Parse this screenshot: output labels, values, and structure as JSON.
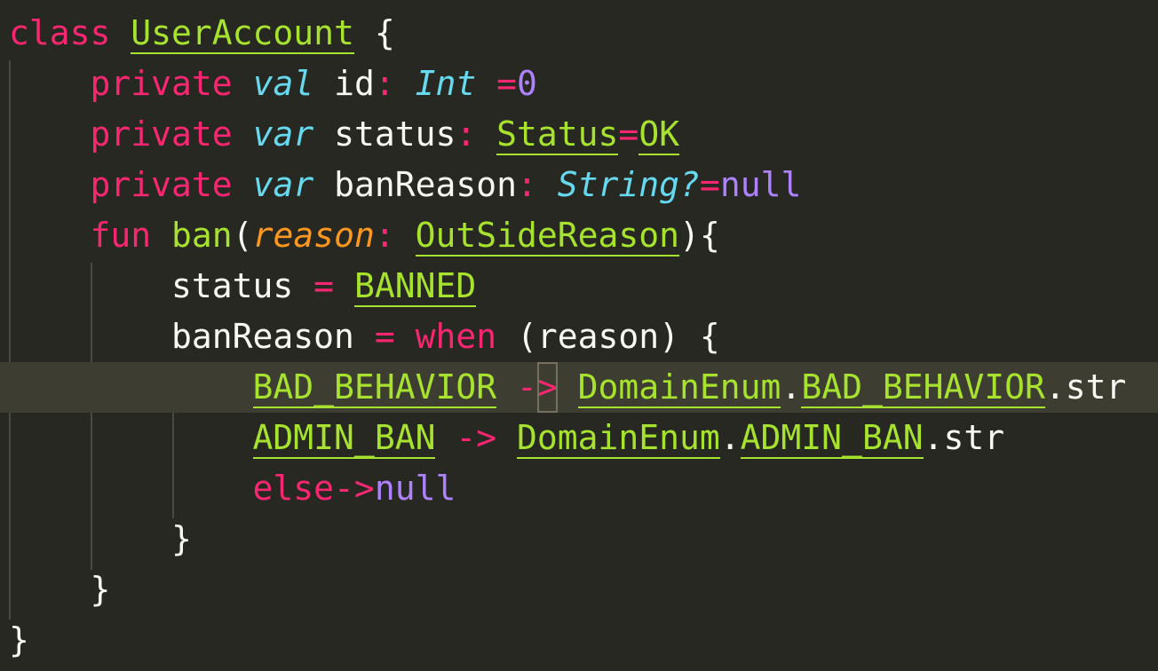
{
  "editor": {
    "lines": [
      [
        [
          "kw",
          "class"
        ],
        [
          "pl",
          " "
        ],
        [
          "ty",
          "UserAccount"
        ],
        [
          "pl",
          " {"
        ]
      ],
      [
        [
          "pl",
          "    "
        ],
        [
          "kw",
          "private"
        ],
        [
          "pl",
          " "
        ],
        [
          "st",
          "val"
        ],
        [
          "pl",
          " id"
        ],
        [
          "kw",
          ":"
        ],
        [
          "pl",
          " "
        ],
        [
          "st",
          "Int"
        ],
        [
          "pl",
          " "
        ],
        [
          "kw",
          "="
        ],
        [
          "nu",
          "0"
        ]
      ],
      [
        [
          "pl",
          "    "
        ],
        [
          "kw",
          "private"
        ],
        [
          "pl",
          " "
        ],
        [
          "st",
          "var"
        ],
        [
          "pl",
          " status"
        ],
        [
          "kw",
          ":"
        ],
        [
          "pl",
          " "
        ],
        [
          "ty",
          "Status"
        ],
        [
          "kw",
          "="
        ],
        [
          "ty",
          "OK"
        ]
      ],
      [
        [
          "pl",
          "    "
        ],
        [
          "kw",
          "private"
        ],
        [
          "pl",
          " "
        ],
        [
          "st",
          "var"
        ],
        [
          "pl",
          " banReason"
        ],
        [
          "kw",
          ":"
        ],
        [
          "pl",
          " "
        ],
        [
          "st",
          "String?"
        ],
        [
          "kw",
          "="
        ],
        [
          "nu",
          "null"
        ]
      ],
      [
        [
          "pl",
          "    "
        ],
        [
          "kw",
          "fun"
        ],
        [
          "pl",
          " "
        ],
        [
          "fn",
          "ban"
        ],
        [
          "pl",
          "("
        ],
        [
          "pa",
          "reason"
        ],
        [
          "kw",
          ":"
        ],
        [
          "pl",
          " "
        ],
        [
          "ty",
          "OutSideReason"
        ],
        [
          "pl",
          "){"
        ]
      ],
      [
        [
          "pl",
          "        status "
        ],
        [
          "kw",
          "="
        ],
        [
          "pl",
          " "
        ],
        [
          "ty",
          "BANNED"
        ]
      ],
      [
        [
          "pl",
          "        banReason "
        ],
        [
          "kw",
          "="
        ],
        [
          "pl",
          " "
        ],
        [
          "kw",
          "when"
        ],
        [
          "pl",
          " (reason) {"
        ]
      ],
      [
        [
          "pl",
          "            "
        ],
        [
          "ty",
          "BAD_BEHAVIOR"
        ],
        [
          "pl",
          " "
        ],
        [
          "kw",
          "-"
        ],
        [
          "kw",
          ">"
        ],
        [
          "pl",
          " "
        ],
        [
          "ty",
          "DomainEnum"
        ],
        [
          "pl",
          "."
        ],
        [
          "ty",
          "BAD_BEHAVIOR"
        ],
        [
          "pl",
          ".str"
        ]
      ],
      [
        [
          "pl",
          "            "
        ],
        [
          "ty",
          "ADMIN_BAN"
        ],
        [
          "pl",
          " "
        ],
        [
          "kw",
          "->"
        ],
        [
          "pl",
          " "
        ],
        [
          "ty",
          "DomainEnum"
        ],
        [
          "pl",
          "."
        ],
        [
          "ty",
          "ADMIN_BAN"
        ],
        [
          "pl",
          ".str"
        ]
      ],
      [
        [
          "pl",
          "            "
        ],
        [
          "kw",
          "else->"
        ],
        [
          "nu",
          "null"
        ]
      ],
      [
        [
          "pl",
          "        }"
        ]
      ],
      [
        [
          "pl",
          "    }"
        ]
      ],
      [
        [
          "pl",
          "}"
        ]
      ]
    ],
    "current_line": 7
  },
  "colors": {
    "background": "#272822",
    "keyword": "#f92672",
    "storage": "#66d9ef",
    "type": "#a6e22e",
    "parameter": "#fd971f",
    "constant": "#ae81ff",
    "text": "#f8f8f2",
    "current_line": "#3e3d32"
  }
}
